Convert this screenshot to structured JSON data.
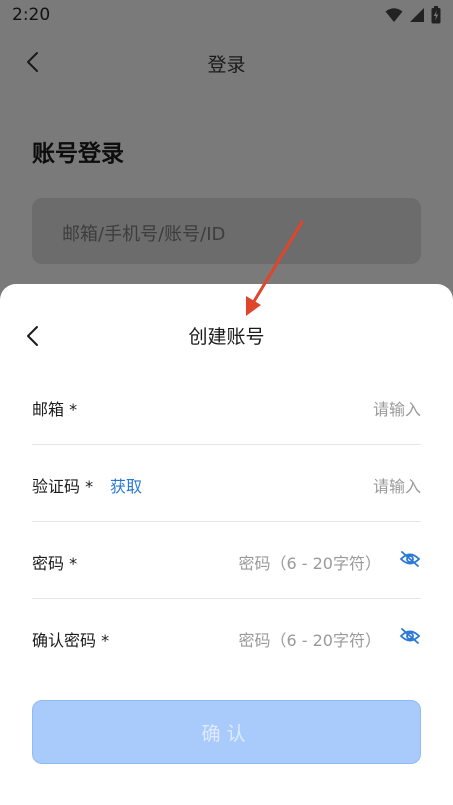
{
  "status_bar": {
    "time": "2:20",
    "icons": [
      "wifi-icon",
      "signal-icon",
      "battery-icon"
    ]
  },
  "background_page": {
    "title": "登录",
    "heading": "账号登录",
    "account_input_placeholder": "邮箱/手机号/账号/ID"
  },
  "sheet": {
    "title": "创建账号",
    "rows": [
      {
        "label": "邮箱 *",
        "placeholder": "请输入"
      },
      {
        "label": "验证码 *",
        "action": "获取",
        "placeholder": "请输入"
      },
      {
        "label": "密码 *",
        "placeholder": "密码（6 - 20字符）",
        "icon": "eye-off-icon"
      },
      {
        "label": "确认密码 *",
        "placeholder": "密码（6 - 20字符）",
        "icon": "eye-off-icon"
      }
    ],
    "confirm_label": "确认"
  },
  "colors": {
    "accent": "#2a78d6",
    "button_disabled_bg": "#a9cbfb",
    "overlay": "#7a7a7a",
    "annotation_arrow": "#e0452c"
  }
}
